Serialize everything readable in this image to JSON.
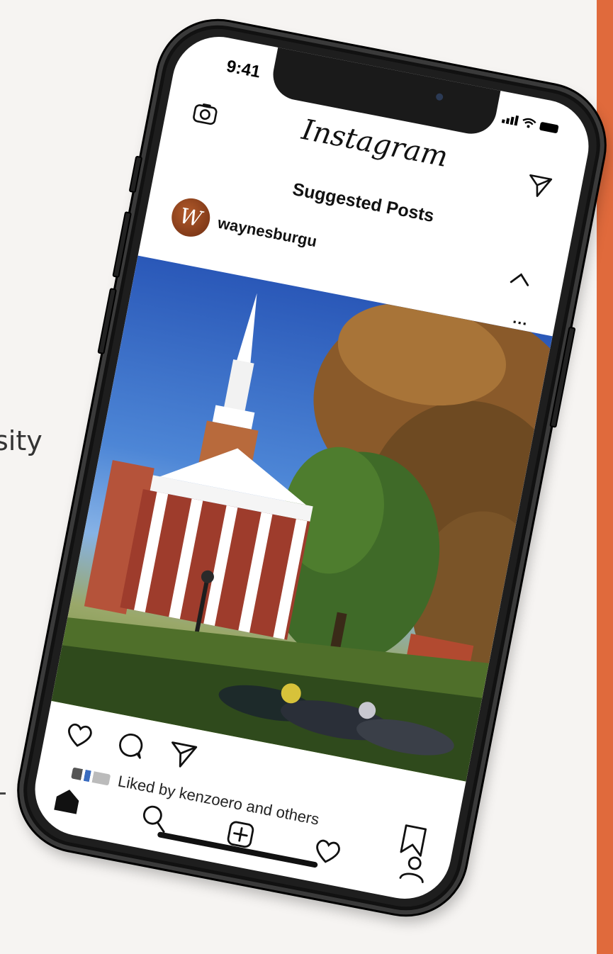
{
  "background": {
    "partial_text": "sity",
    "accent_color": "#e06a3c"
  },
  "status_bar": {
    "time": "9:41"
  },
  "header": {
    "app_title": "Instagram",
    "camera_icon": "camera-icon",
    "send_icon": "paper-plane-icon"
  },
  "feed": {
    "section_title": "Suggested Posts",
    "post": {
      "avatar_letter": "W",
      "username": "waynesburgu",
      "more_label": "...",
      "liked_by_text": "Liked by kenzoero and others"
    }
  },
  "post_actions": [
    "heart-icon",
    "comment-icon",
    "share-icon",
    "bookmark-icon"
  ],
  "tab_bar": [
    "home-icon",
    "search-icon",
    "add-post-icon",
    "activity-heart-icon",
    "profile-icon"
  ]
}
